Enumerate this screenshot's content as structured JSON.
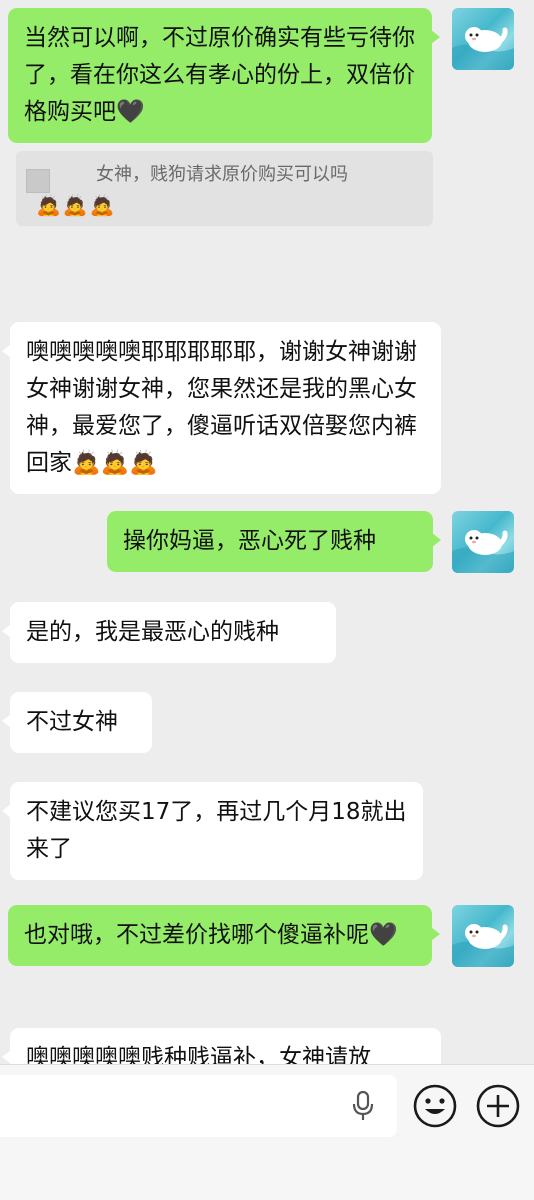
{
  "messages": [
    {
      "side": "sent",
      "text": "当然可以啊，不过原价确实有些亏待你了，看在你这么有孝心的份上，双倍价格购买吧🖤"
    },
    {
      "side": "quote",
      "text": "女神，贱狗请求原价购买可以吗",
      "emojis": "🙇🙇🙇"
    },
    {
      "side": "recv",
      "text": "噢噢噢噢噢耶耶耶耶耶，谢谢女神谢谢女神谢谢女神，您果然还是我的黑心女神，最爱您了，傻逼听话双倍娶您内裤回家🙇🙇🙇"
    },
    {
      "side": "sent",
      "text": "操你妈逼，恶心死了贱种"
    },
    {
      "side": "recv",
      "text": "是的，我是最恶心的贱种"
    },
    {
      "side": "recv",
      "text": "不过女神"
    },
    {
      "side": "recv",
      "text": "不建议您买17了，再过几个月18就出来了"
    },
    {
      "side": "sent",
      "text": "也对哦，不过差价找哪个傻逼补呢🖤"
    },
    {
      "side": "recv",
      "text": "噢噢噢噢噢贱种贱逼补，女神请放"
    }
  ],
  "input": {
    "value": "",
    "icons": [
      "mic-icon",
      "smile-icon",
      "plus-icon"
    ]
  },
  "colors": {
    "sent": "#95ec69",
    "recv": "#ffffff",
    "background": "#ededed"
  }
}
